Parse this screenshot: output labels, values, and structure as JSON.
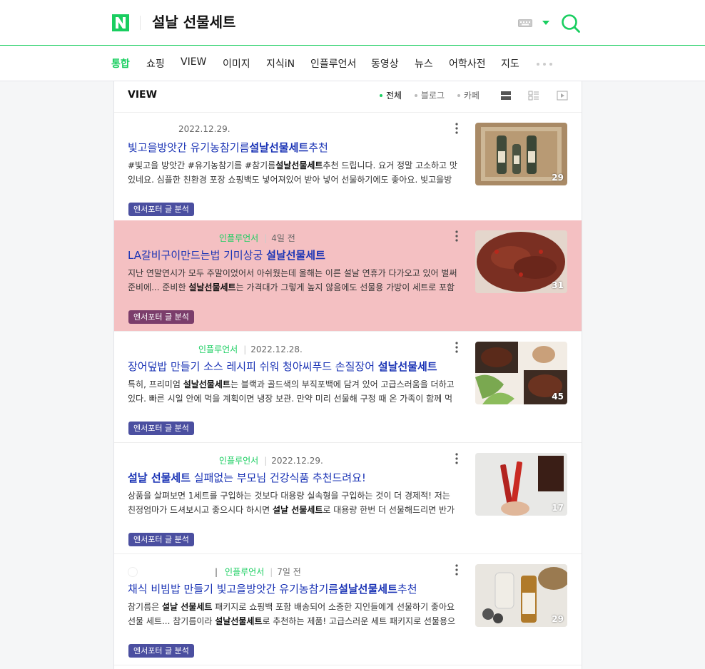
{
  "header": {
    "logo_letter": "N",
    "query": "설날 선물세트",
    "brand_color": "#19ce60"
  },
  "tabs": [
    {
      "label": "통합",
      "active": true
    },
    {
      "label": "쇼핑"
    },
    {
      "label": "VIEW"
    },
    {
      "label": "이미지"
    },
    {
      "label": "지식iN"
    },
    {
      "label": "인플루언서"
    },
    {
      "label": "동영상"
    },
    {
      "label": "뉴스"
    },
    {
      "label": "어학사전"
    },
    {
      "label": "지도"
    }
  ],
  "view": {
    "title": "VIEW",
    "filters": [
      "전체",
      "블로그",
      "카페"
    ]
  },
  "items": [
    {
      "source": "",
      "date": "2022.12.29.",
      "title_parts": [
        {
          "t": "빛고을방앗간 유기농참기름"
        },
        {
          "t": "설날선물세트",
          "b": true
        },
        {
          "t": "추천"
        }
      ],
      "desc_parts": [
        {
          "t": "#빛고을 방앗간 #유기농참기름 #참기름"
        },
        {
          "b": true,
          "t": "설날선물세트"
        },
        {
          "t": "추천 드립니다. 요거 정말 고소하고 맛있네요. 심플한 친환경 포장 쇼핑백도 넣어져있어 받아 넣어 선물하기에도 좋아요. 빛고을방앗간은...."
        }
      ],
      "badge": "엔서포터 글 분석",
      "count": "29",
      "highlight": false
    },
    {
      "source": "인플루언서",
      "date": "4일 전",
      "title_parts": [
        {
          "t": "LA갈비구이만드는법 기미상궁 "
        },
        {
          "t": "설날선물세트",
          "b": true
        }
      ],
      "desc_parts": [
        {
          "t": "지난 연말연시가 모두 주말이었어서 아쉬웠는데 올해는 이른 설날 연휴가 다가오고 있어 벌써 준비에... 준비한 "
        },
        {
          "b": true,
          "t": "설날선물세트"
        },
        {
          "t": "는 가격대가 그렇게 높지 않음에도 선물용 가방이 세트로 포함된 ..."
        }
      ],
      "badge": "엔서포터 글 분석",
      "count": "31",
      "highlight": true
    },
    {
      "source": "인플루언서",
      "date": "2022.12.28.",
      "title_parts": [
        {
          "t": "장어덮밥 만들기 소스 레시피 쉬워 청아씨푸드 손질장어 "
        },
        {
          "t": "설날선물세트",
          "b": true
        }
      ],
      "desc_parts": [
        {
          "t": "특히, 프리미엄 "
        },
        {
          "b": true,
          "t": "설날선물세트"
        },
        {
          "t": "는 블랙과 골드색의 부직포백에 담겨 있어 고급스러움을 더하고 있다. 빠른 시일 안에 먹을 계획이면 냉장 보관. 만약 미리 선물해 구정 때 온 가족이 함께 먹을 용..."
        }
      ],
      "badge": "엔서포터 글 분석",
      "count": "45",
      "highlight": false
    },
    {
      "source": "인플루언서",
      "date": "2022.12.29.",
      "title_parts": [
        {
          "t": "설날 선물세트",
          "b": true
        },
        {
          "t": " 실패없는 부모님 건강식품 추천드려요!"
        }
      ],
      "desc_parts": [
        {
          "t": "상품을 살펴보면 1세트를 구입하는 것보다 대용량 실속형을 구입하는 것이 더 경제적! 저는 친정엄마가 드셔보시고 좋으시다 하시면 "
        },
        {
          "b": true,
          "t": "설날 선물세트"
        },
        {
          "t": "로 대용량 한번 더 선물해드리면 반가워 하..."
        }
      ],
      "badge": "엔서포터 글 분석",
      "count": "17",
      "highlight": false
    },
    {
      "source": "인플루언서",
      "date": "7일 전",
      "title_parts": [
        {
          "t": "채식 비빔밥 만들기 빛고을방앗간 유기농참기름"
        },
        {
          "t": "설날선물세트",
          "b": true
        },
        {
          "t": "추천"
        }
      ],
      "desc_parts": [
        {
          "t": "참기름은 "
        },
        {
          "b": true,
          "t": "설날 선물세트"
        },
        {
          "t": " 패키지로 쇼핑백 포함 배송되어 소중한 지인들에게 선물하기 좋아요 선물 세트... 참기름이라 "
        },
        {
          "b": true,
          "t": "설날선물세트"
        },
        {
          "t": "로 추천하는 제품! 고급스러운 세트 패키지로 선물용으로 ..."
        }
      ],
      "badge": "엔서포터 글 분석",
      "count": "29",
      "highlight": false
    }
  ]
}
